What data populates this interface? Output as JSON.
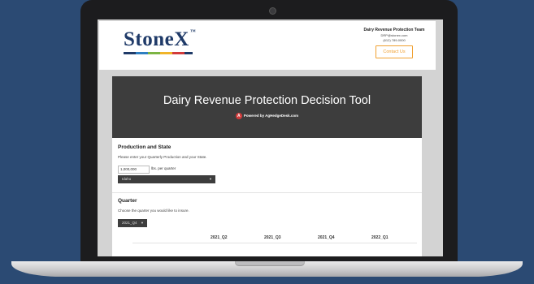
{
  "header": {
    "logo": "StoneX",
    "logo_tm": "™",
    "stripe_colors": [
      "#1f3a68",
      "#2e7fc1",
      "#7cb443",
      "#f0b429",
      "#d23b3b",
      "#1f3a68"
    ],
    "team_name": "Dairy Revenue Protection Team",
    "team_email": "DRP@stonex.com",
    "team_phone": "(612) 789-0000",
    "contact_label": "Contact Us"
  },
  "banner": {
    "title": "Dairy Revenue Protection Decision Tool",
    "powered_by": "Powered by AgHedgeDesk.com",
    "icon_glyph": "A"
  },
  "production": {
    "title": "Production and State",
    "description": "Please enter your Quarterly Production and your State.",
    "value": "1,000,000",
    "unit": "lbs. per quarter",
    "state": "Idaho"
  },
  "quarter": {
    "title": "Quarter",
    "description": "Choose the quarter you would like to insure.",
    "selected": "2021_Q4"
  },
  "table": {
    "columns": [
      "2021_Q2",
      "2021_Q3",
      "2021_Q4",
      "2022_Q1"
    ]
  },
  "colors": {
    "background": "#2b4a73",
    "banner": "#3d3d3d",
    "accent": "#f0a030"
  }
}
